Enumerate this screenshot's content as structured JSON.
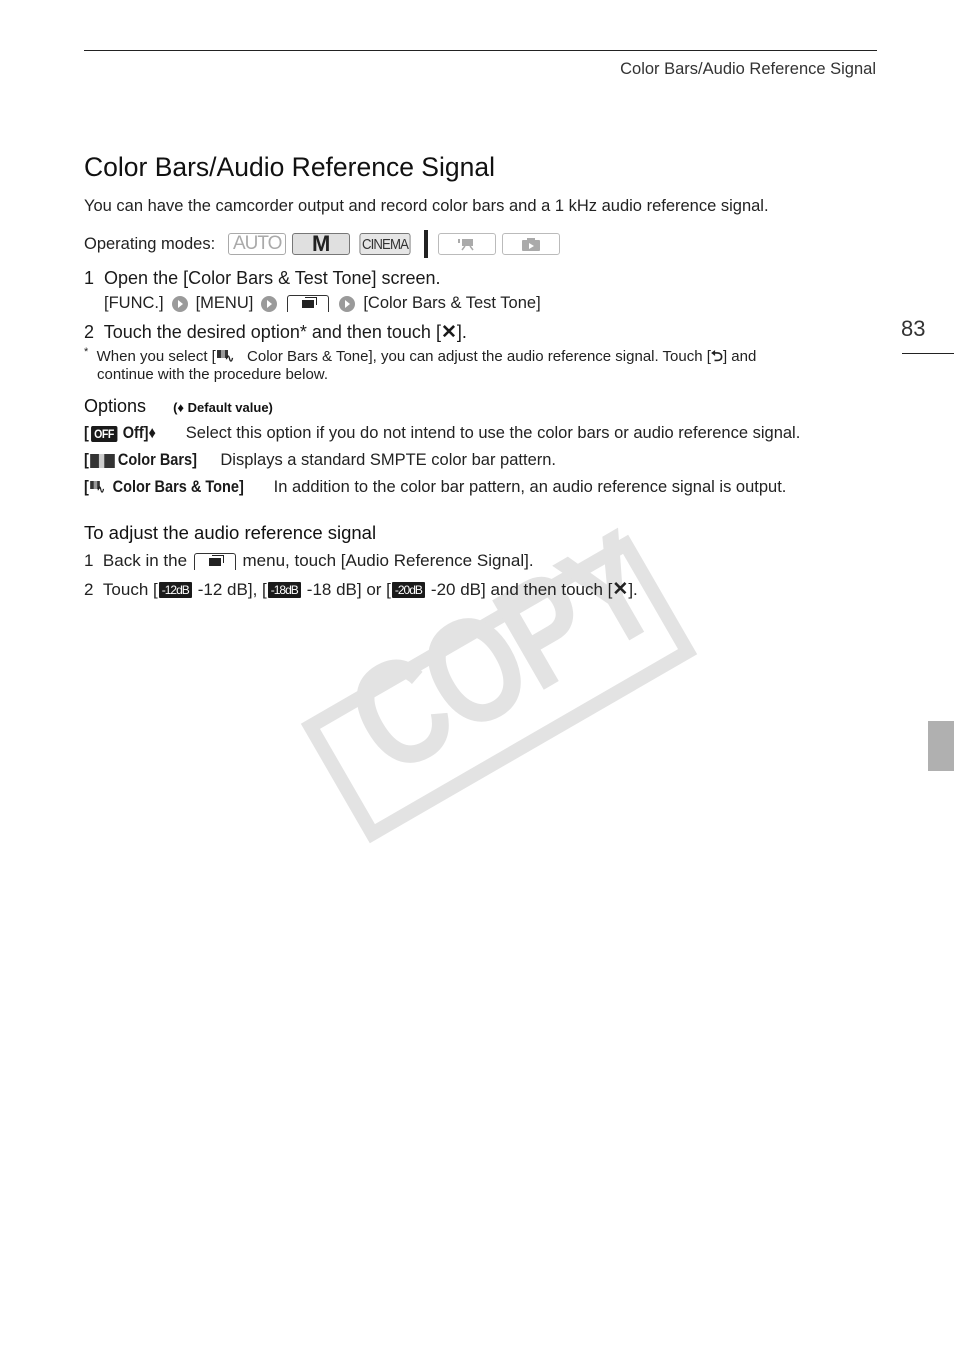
{
  "header": {
    "running_head": "Color Bars/Audio Reference Signal",
    "page_number": "83"
  },
  "title": "Color Bars/Audio Reference Signal",
  "intro": "You can have the camcorder output and record color bars and a 1 kHz audio reference signal.",
  "operating_modes": {
    "label": "Operating modes:",
    "modes": [
      {
        "name": "AUTO",
        "active": false
      },
      {
        "name": "M",
        "active": true
      },
      {
        "name": "CINEMA",
        "active": true
      },
      {
        "name": "movie-playback",
        "active": false
      },
      {
        "name": "photo-playback",
        "active": false
      }
    ]
  },
  "steps": {
    "step1_num": "1",
    "step1": "Open the [Color Bars & Test Tone] screen.",
    "path": {
      "func": "[FUNC.]",
      "menu": "[MENU]",
      "target": "[Color Bars & Test Tone]"
    },
    "step2_num": "2",
    "step2_pre": "Touch the desired option* and then touch [",
    "step2_post": "].",
    "x_glyph": "✕"
  },
  "footnote": {
    "star": "*",
    "pre": "When you select [",
    "mid": " Color Bars & Tone], you can adjust the audio reference signal. Touch [",
    "post": "] and",
    "line2": "continue with the procedure below.",
    "back_glyph": "⮌"
  },
  "options": {
    "title": "Options",
    "default_note": "(♦ Default value)",
    "items": [
      {
        "open": "[",
        "icon_text": "OFF",
        "label": "Off]♦",
        "desc": "Select this option if you do not intend to use the color bars or audio reference signal."
      },
      {
        "open": "[",
        "label": "Color Bars]",
        "desc": "Displays a standard SMPTE color bar pattern."
      },
      {
        "open": "[",
        "label": "Color Bars & Tone]",
        "desc": "In addition to the color bar pattern, an audio reference signal is output."
      }
    ]
  },
  "adjust": {
    "heading": "To adjust the audio reference signal",
    "step1_num": "1",
    "step1_pre": "Back in the",
    "step1_post": "menu, touch [Audio Reference Signal].",
    "step2_num": "2",
    "step2_a": "Touch [",
    "icon_12": "-12dB",
    "t_12": "-12 dB], [",
    "icon_18": "-18dB",
    "t_18": "-18 dB] or [",
    "icon_20": "-20dB",
    "t_20": "-20 dB] and then touch [",
    "x_glyph": "✕",
    "end": "]."
  },
  "watermark": "COPY"
}
